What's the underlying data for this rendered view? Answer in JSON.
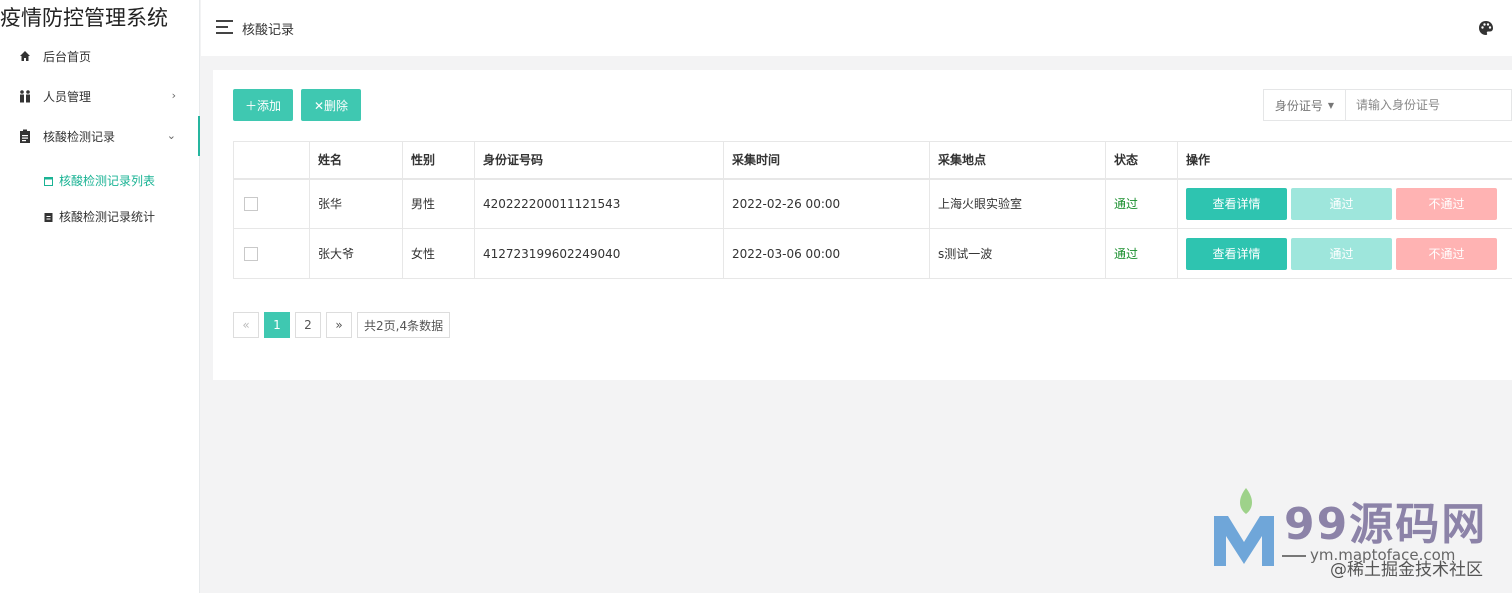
{
  "app": {
    "title": "疫情防控管理系统"
  },
  "sidebar": {
    "items": [
      {
        "label": "后台首页",
        "icon": "home-icon"
      },
      {
        "label": "人员管理",
        "icon": "people-icon",
        "arrow": "›"
      },
      {
        "label": "核酸检测记录",
        "icon": "clipboard-icon",
        "arrow": "⌄"
      }
    ],
    "subitems": [
      {
        "label": "核酸检测记录列表",
        "icon": "calendar-icon"
      },
      {
        "label": "核酸检测记录统计",
        "icon": "clipboard-small-icon"
      }
    ],
    "accent": "#26b59f"
  },
  "header": {
    "breadcrumb": "核酸记录",
    "menu_icon": "hamburger-icon",
    "theme_icon": "palette-icon"
  },
  "toolbar": {
    "add_label": "＋添加",
    "delete_label": "✕删除"
  },
  "search": {
    "type_label": "身份证号",
    "placeholder": "请输入身份证号"
  },
  "table": {
    "headers": [
      "",
      "姓名",
      "性别",
      "身份证号码",
      "采集时间",
      "采集地点",
      "状态",
      "操作"
    ],
    "rows": [
      {
        "name": "张华",
        "gender": "男性",
        "id_number": "420222200011121543",
        "time": "2022-02-26 00:00",
        "place": "上海火眼实验室",
        "status": "通过"
      },
      {
        "name": "张大爷",
        "gender": "女性",
        "id_number": "412723199602249040",
        "time": "2022-03-06 00:00",
        "place": "s测试一波",
        "status": "通过"
      }
    ],
    "actions": {
      "view": "查看详情",
      "pass": "通过",
      "fail": "不通过"
    }
  },
  "pagination": {
    "prev": "«",
    "pages": [
      "1",
      "2"
    ],
    "next": "»",
    "info": "共2页,4条数据",
    "current": "1"
  },
  "watermark": {
    "title": "99源码网",
    "url": "ym.maptoface.com",
    "footer": "@稀土掘金技术社区"
  },
  "colors": {
    "primary": "#3fc8b1",
    "view": "#2ec4b0",
    "pass": "#9ee6dc",
    "fail": "#ffb3b3",
    "status_ok": "#1a8f2e"
  }
}
